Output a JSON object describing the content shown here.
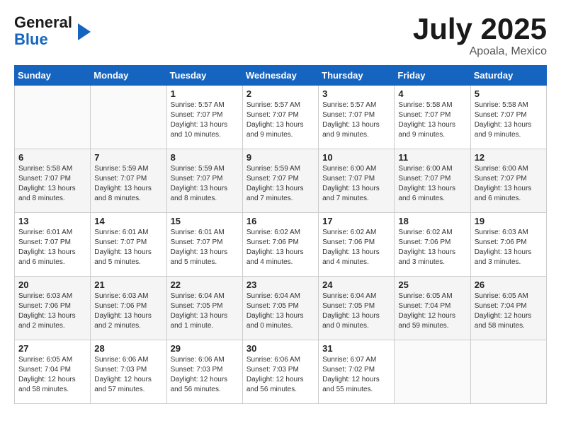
{
  "header": {
    "logo_line1": "General",
    "logo_line2": "Blue",
    "month": "July 2025",
    "location": "Apoala, Mexico"
  },
  "weekdays": [
    "Sunday",
    "Monday",
    "Tuesday",
    "Wednesday",
    "Thursday",
    "Friday",
    "Saturday"
  ],
  "weeks": [
    [
      {
        "day": "",
        "info": ""
      },
      {
        "day": "",
        "info": ""
      },
      {
        "day": "1",
        "info": "Sunrise: 5:57 AM\nSunset: 7:07 PM\nDaylight: 13 hours\nand 10 minutes."
      },
      {
        "day": "2",
        "info": "Sunrise: 5:57 AM\nSunset: 7:07 PM\nDaylight: 13 hours\nand 9 minutes."
      },
      {
        "day": "3",
        "info": "Sunrise: 5:57 AM\nSunset: 7:07 PM\nDaylight: 13 hours\nand 9 minutes."
      },
      {
        "day": "4",
        "info": "Sunrise: 5:58 AM\nSunset: 7:07 PM\nDaylight: 13 hours\nand 9 minutes."
      },
      {
        "day": "5",
        "info": "Sunrise: 5:58 AM\nSunset: 7:07 PM\nDaylight: 13 hours\nand 9 minutes."
      }
    ],
    [
      {
        "day": "6",
        "info": "Sunrise: 5:58 AM\nSunset: 7:07 PM\nDaylight: 13 hours\nand 8 minutes."
      },
      {
        "day": "7",
        "info": "Sunrise: 5:59 AM\nSunset: 7:07 PM\nDaylight: 13 hours\nand 8 minutes."
      },
      {
        "day": "8",
        "info": "Sunrise: 5:59 AM\nSunset: 7:07 PM\nDaylight: 13 hours\nand 8 minutes."
      },
      {
        "day": "9",
        "info": "Sunrise: 5:59 AM\nSunset: 7:07 PM\nDaylight: 13 hours\nand 7 minutes."
      },
      {
        "day": "10",
        "info": "Sunrise: 6:00 AM\nSunset: 7:07 PM\nDaylight: 13 hours\nand 7 minutes."
      },
      {
        "day": "11",
        "info": "Sunrise: 6:00 AM\nSunset: 7:07 PM\nDaylight: 13 hours\nand 6 minutes."
      },
      {
        "day": "12",
        "info": "Sunrise: 6:00 AM\nSunset: 7:07 PM\nDaylight: 13 hours\nand 6 minutes."
      }
    ],
    [
      {
        "day": "13",
        "info": "Sunrise: 6:01 AM\nSunset: 7:07 PM\nDaylight: 13 hours\nand 6 minutes."
      },
      {
        "day": "14",
        "info": "Sunrise: 6:01 AM\nSunset: 7:07 PM\nDaylight: 13 hours\nand 5 minutes."
      },
      {
        "day": "15",
        "info": "Sunrise: 6:01 AM\nSunset: 7:07 PM\nDaylight: 13 hours\nand 5 minutes."
      },
      {
        "day": "16",
        "info": "Sunrise: 6:02 AM\nSunset: 7:06 PM\nDaylight: 13 hours\nand 4 minutes."
      },
      {
        "day": "17",
        "info": "Sunrise: 6:02 AM\nSunset: 7:06 PM\nDaylight: 13 hours\nand 4 minutes."
      },
      {
        "day": "18",
        "info": "Sunrise: 6:02 AM\nSunset: 7:06 PM\nDaylight: 13 hours\nand 3 minutes."
      },
      {
        "day": "19",
        "info": "Sunrise: 6:03 AM\nSunset: 7:06 PM\nDaylight: 13 hours\nand 3 minutes."
      }
    ],
    [
      {
        "day": "20",
        "info": "Sunrise: 6:03 AM\nSunset: 7:06 PM\nDaylight: 13 hours\nand 2 minutes."
      },
      {
        "day": "21",
        "info": "Sunrise: 6:03 AM\nSunset: 7:06 PM\nDaylight: 13 hours\nand 2 minutes."
      },
      {
        "day": "22",
        "info": "Sunrise: 6:04 AM\nSunset: 7:05 PM\nDaylight: 13 hours\nand 1 minute."
      },
      {
        "day": "23",
        "info": "Sunrise: 6:04 AM\nSunset: 7:05 PM\nDaylight: 13 hours\nand 0 minutes."
      },
      {
        "day": "24",
        "info": "Sunrise: 6:04 AM\nSunset: 7:05 PM\nDaylight: 13 hours\nand 0 minutes."
      },
      {
        "day": "25",
        "info": "Sunrise: 6:05 AM\nSunset: 7:04 PM\nDaylight: 12 hours\nand 59 minutes."
      },
      {
        "day": "26",
        "info": "Sunrise: 6:05 AM\nSunset: 7:04 PM\nDaylight: 12 hours\nand 58 minutes."
      }
    ],
    [
      {
        "day": "27",
        "info": "Sunrise: 6:05 AM\nSunset: 7:04 PM\nDaylight: 12 hours\nand 58 minutes."
      },
      {
        "day": "28",
        "info": "Sunrise: 6:06 AM\nSunset: 7:03 PM\nDaylight: 12 hours\nand 57 minutes."
      },
      {
        "day": "29",
        "info": "Sunrise: 6:06 AM\nSunset: 7:03 PM\nDaylight: 12 hours\nand 56 minutes."
      },
      {
        "day": "30",
        "info": "Sunrise: 6:06 AM\nSunset: 7:03 PM\nDaylight: 12 hours\nand 56 minutes."
      },
      {
        "day": "31",
        "info": "Sunrise: 6:07 AM\nSunset: 7:02 PM\nDaylight: 12 hours\nand 55 minutes."
      },
      {
        "day": "",
        "info": ""
      },
      {
        "day": "",
        "info": ""
      }
    ]
  ]
}
